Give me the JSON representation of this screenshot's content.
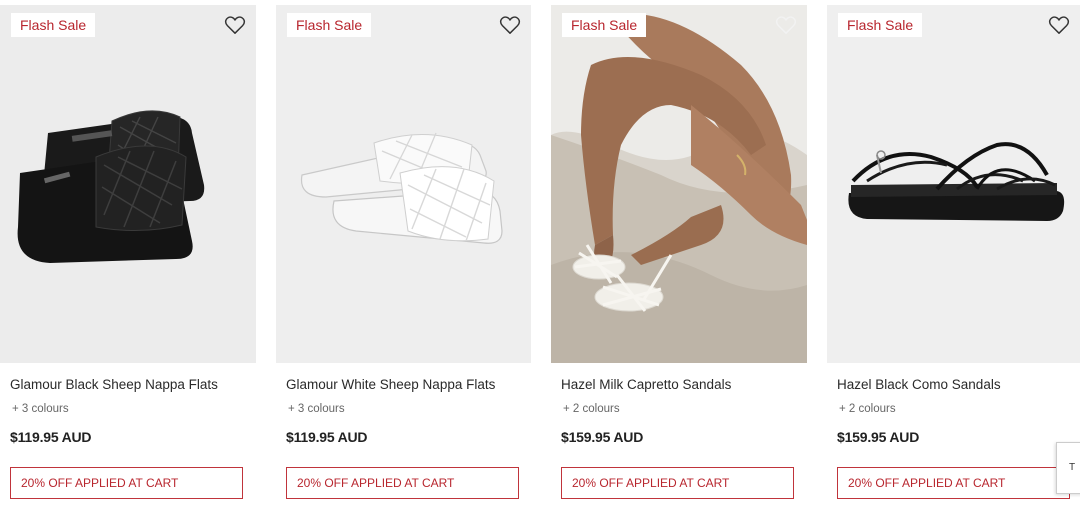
{
  "products": [
    {
      "badge": "Flash Sale",
      "name": "Glamour Black Sheep Nappa Flats",
      "colours": "+ 3 colours",
      "price": "$119.95 AUD",
      "promo": "20% OFF APPLIED AT CART"
    },
    {
      "badge": "Flash Sale",
      "name": "Glamour White Sheep Nappa Flats",
      "colours": "+ 3 colours",
      "price": "$119.95 AUD",
      "promo": "20% OFF APPLIED AT CART"
    },
    {
      "badge": "Flash Sale",
      "name": "Hazel Milk Capretto Sandals",
      "colours": "+ 2 colours",
      "price": "$159.95 AUD",
      "promo": "20% OFF APPLIED AT CART"
    },
    {
      "badge": "Flash Sale",
      "name": "Hazel Black Como Sandals",
      "colours": "+ 2 colours",
      "price": "$159.95 AUD",
      "promo": "20% OFF APPLIED AT CART"
    }
  ],
  "side_tab_label": "T",
  "colors": {
    "sale_red": "#b8262e",
    "image_bg": "#ebebeb",
    "text": "#2a2a2a"
  },
  "icons": {
    "wishlist": "heart-outline-icon"
  }
}
